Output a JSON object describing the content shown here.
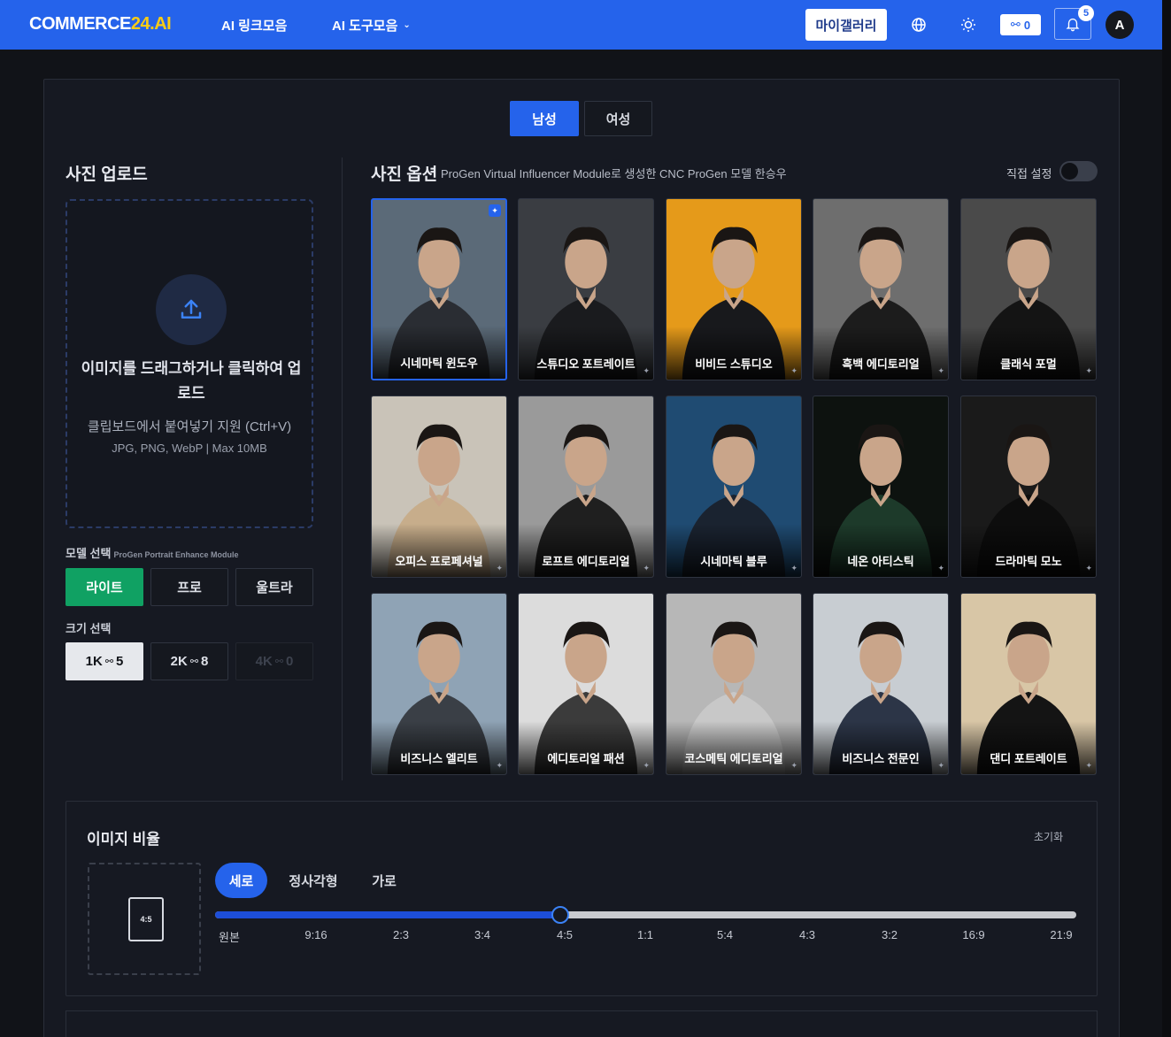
{
  "nav": {
    "logo_main": "COMMERCE",
    "logo_accent": "24.AI",
    "link_ai_links": "AI 링크모음",
    "link_ai_tools": "AI 도구모음",
    "gallery_button": "마이갤러리",
    "credits": "0",
    "notifications_count": "5",
    "avatar_initial": "A"
  },
  "gender_tabs": {
    "male": "남성",
    "female": "여성",
    "selected": "male"
  },
  "upload": {
    "title": "사진 업로드",
    "main_text": "이미지를 드래그하거나 클릭하여 업로드",
    "clipboard_text": "클립보드에서 붙여넣기 지원 (Ctrl+V)",
    "formats": "JPG, PNG, WebP | Max 10MB"
  },
  "model_select": {
    "label": "모델 선택",
    "module": "ProGen Portrait Enhance Module",
    "options": [
      "라이트",
      "프로",
      "울트라"
    ],
    "selected": "라이트"
  },
  "size_select": {
    "label": "크기 선택",
    "options": [
      {
        "label": "1K",
        "cost": "5"
      },
      {
        "label": "2K",
        "cost": "8"
      },
      {
        "label": "4K",
        "cost": "0"
      }
    ],
    "selected": "1K"
  },
  "photo_options": {
    "title": "사진 옵션",
    "subtitle": "ProGen Virtual Influencer Module로 생성한 CNC ProGen 모델 한승우",
    "custom_toggle_label": "직접 설정",
    "custom_toggle_on": false,
    "selected": "시네마틱 윈도우",
    "styles": [
      {
        "label": "시네마틱 윈도우",
        "bg": "#5b6a78",
        "tone": "#2a2d33"
      },
      {
        "label": "스튜디오 포트레이트",
        "bg": "#3a3d42",
        "tone": "#1a1b1e"
      },
      {
        "label": "비비드 스튜디오",
        "bg": "#e59a1a",
        "tone": "#18191c"
      },
      {
        "label": "흑백 에디토리얼",
        "bg": "#6e6e6e",
        "tone": "#1c1c1c"
      },
      {
        "label": "클래식 포멀",
        "bg": "#4a4a4a",
        "tone": "#141414"
      },
      {
        "label": "오피스 프로페셔널",
        "bg": "#c9c3b8",
        "tone": "#c7ad8b"
      },
      {
        "label": "로프트 에디토리얼",
        "bg": "#9a9a9a",
        "tone": "#1f1f1f"
      },
      {
        "label": "시네마틱 블루",
        "bg": "#1f4b72",
        "tone": "#1a2330"
      },
      {
        "label": "네온 아티스틱",
        "bg": "#0d120f",
        "tone": "#1d3a2a"
      },
      {
        "label": "드라마틱 모노",
        "bg": "#1a1a1a",
        "tone": "#0d0d0d"
      },
      {
        "label": "비즈니스 엘리트",
        "bg": "#8fa3b5",
        "tone": "#3a3f46"
      },
      {
        "label": "에디토리얼 패션",
        "bg": "#dcdcdc",
        "tone": "#3b3b3b"
      },
      {
        "label": "코스메틱 에디토리얼",
        "bg": "#b7b7b7",
        "tone": "#c8c8c8"
      },
      {
        "label": "비즈니스 전문인",
        "bg": "#c8cdd2",
        "tone": "#2c3547"
      },
      {
        "label": "댄디 포트레이트",
        "bg": "#d8c6a6",
        "tone": "#141414"
      }
    ]
  },
  "ratio": {
    "title": "이미지 비율",
    "reset": "초기화",
    "preview_label": "4:5",
    "orientations": [
      "세로",
      "정사각형",
      "가로"
    ],
    "selected_orientation": "세로",
    "ticks": [
      "원본",
      "9:16",
      "2:3",
      "3:4",
      "4:5",
      "1:1",
      "5:4",
      "4:3",
      "3:2",
      "16:9",
      "21:9"
    ],
    "selected_tick": "4:5"
  },
  "colors": {
    "accent": "#2563eb",
    "green": "#10a163",
    "bg": "#111318"
  }
}
